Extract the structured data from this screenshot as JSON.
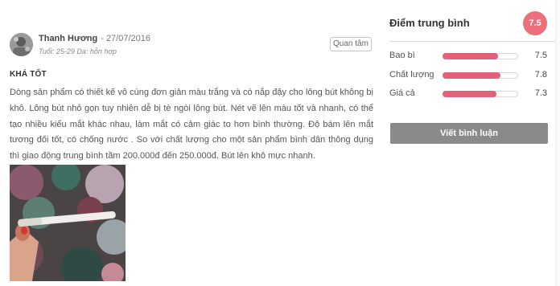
{
  "review": {
    "author_name": "Thanh Hương",
    "date": "- 27/07/2016",
    "meta": "Tuổi: 25-29  Da: hỗn hợp",
    "follow_label": "Quan tâm",
    "title": "KHÁ TỐT",
    "body": "Dòng sản phẩm có thiết kế vô cùng đơn giản màu trắng và có nắp đậy cho lông bút không bị khô. Lông bút nhỏ gọn tuy nhiên dễ bị tè ngòi lông bút. Nét vẽ lên màu tốt và nhanh, có thể tạo nhiều kiểu mắt khác nhau, làm mắt có cảm giác to hơn bình thường. Độ bám lên mắt tương đối tốt, có chống nước . So với chất lượng cho một sản phẩm bình dân thông dụng thì giao động trung bình tầm 200.000đ đến 250.000đ. Bút lên khô mực nhanh."
  },
  "sidebar": {
    "avg_title": "Điểm trung bình",
    "avg_score": "7.5",
    "ratings": [
      {
        "label": "Bao bì",
        "score": "7.5",
        "value": 7.5,
        "max": 10
      },
      {
        "label": "Chất lượng",
        "score": "7.8",
        "value": 7.8,
        "max": 10
      },
      {
        "label": "Giá cả",
        "score": "7.3",
        "value": 7.3,
        "max": 10
      }
    ],
    "write_label": "Viết bình luận",
    "accent_color": "#e26379",
    "badge_color": "#ec6f7c"
  }
}
